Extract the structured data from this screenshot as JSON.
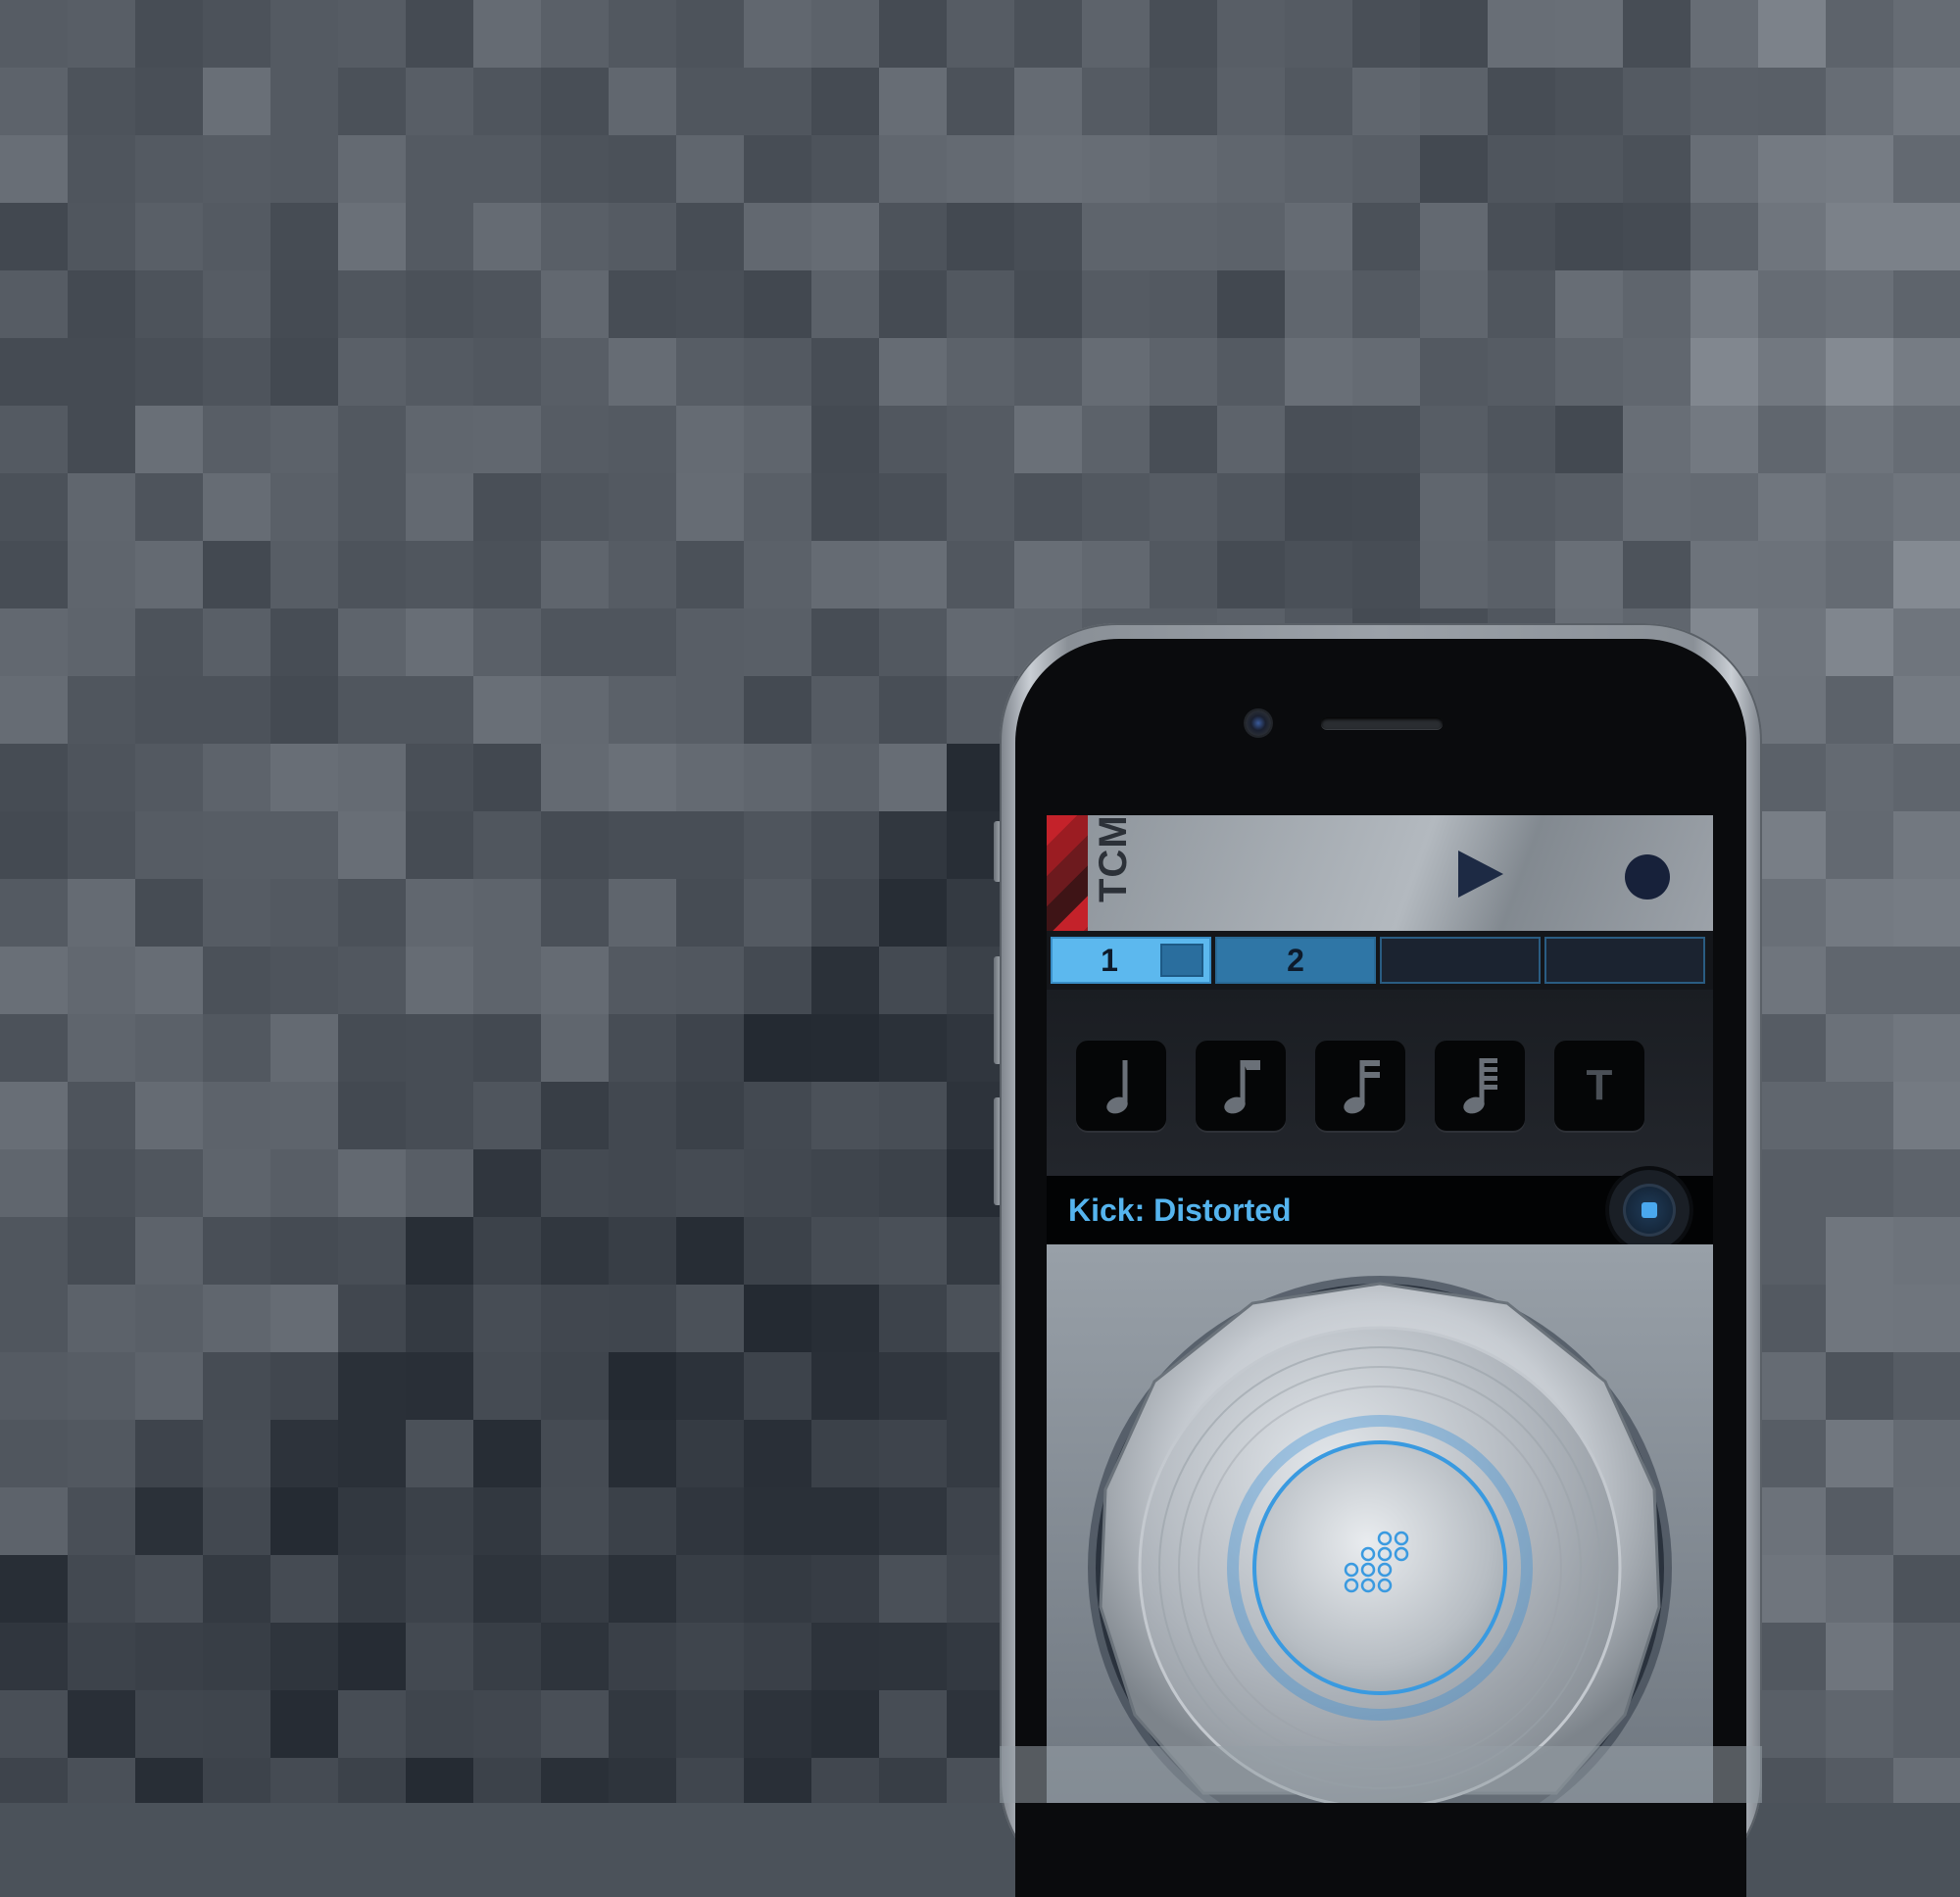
{
  "app": {
    "logo_text": "TCM",
    "colors": {
      "accent": "#55b4ee",
      "record": "#17213a",
      "brand_red": "#c4222a"
    }
  },
  "transport": {
    "play_icon": "play-icon",
    "record_icon": "record-icon"
  },
  "patterns": [
    {
      "label": "1",
      "state": "active"
    },
    {
      "label": "2",
      "state": "filled"
    },
    {
      "label": "",
      "state": "empty"
    },
    {
      "label": "",
      "state": "empty"
    }
  ],
  "note_buttons": [
    {
      "icon": "quarter-note-icon"
    },
    {
      "icon": "eighth-note-icon"
    },
    {
      "icon": "sixteenth-note-icon"
    },
    {
      "icon": "thirty-second-note-icon"
    },
    {
      "label": "T"
    }
  ],
  "sound": {
    "name": "Kick: Distorted",
    "stop_icon": "stop-icon"
  },
  "pad": {
    "icon": "dots-grid-icon"
  }
}
